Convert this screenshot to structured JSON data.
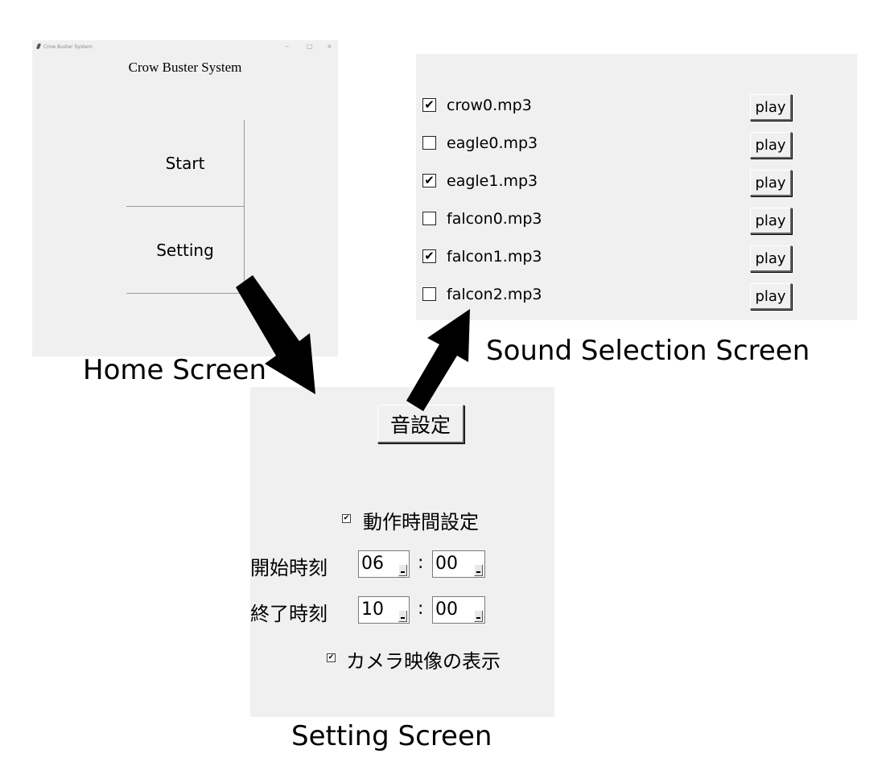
{
  "captions": {
    "home": "Home Screen",
    "sound": "Sound Selection Screen",
    "setting": "Setting Screen"
  },
  "home": {
    "window_title": "Crow Buster System",
    "window_controls": [
      "–",
      "□",
      "×"
    ],
    "app_title": "Crow Buster System",
    "start_label": "Start",
    "setting_label": "Setting"
  },
  "sound": {
    "items": [
      {
        "checked": true,
        "file": "crow0.mp3",
        "button": "play"
      },
      {
        "checked": false,
        "file": "eagle0.mp3",
        "button": "play"
      },
      {
        "checked": true,
        "file": "eagle1.mp3",
        "button": "play"
      },
      {
        "checked": false,
        "file": "falcon0.mp3",
        "button": "play"
      },
      {
        "checked": true,
        "file": "falcon1.mp3",
        "button": "play"
      },
      {
        "checked": false,
        "file": "falcon2.mp3",
        "button": "play"
      }
    ]
  },
  "setting": {
    "sound_button": "音設定",
    "operation_time": {
      "checked": true,
      "label": "動作時間設定"
    },
    "start_time": {
      "label": "開始時刻",
      "hour": "06",
      "minute": "00"
    },
    "end_time": {
      "label": "終了時刻",
      "hour": "10",
      "minute": "00"
    },
    "time_separator": ":",
    "camera": {
      "checked": true,
      "label": "カメラ映像の表示"
    }
  },
  "check_mark": "✔"
}
